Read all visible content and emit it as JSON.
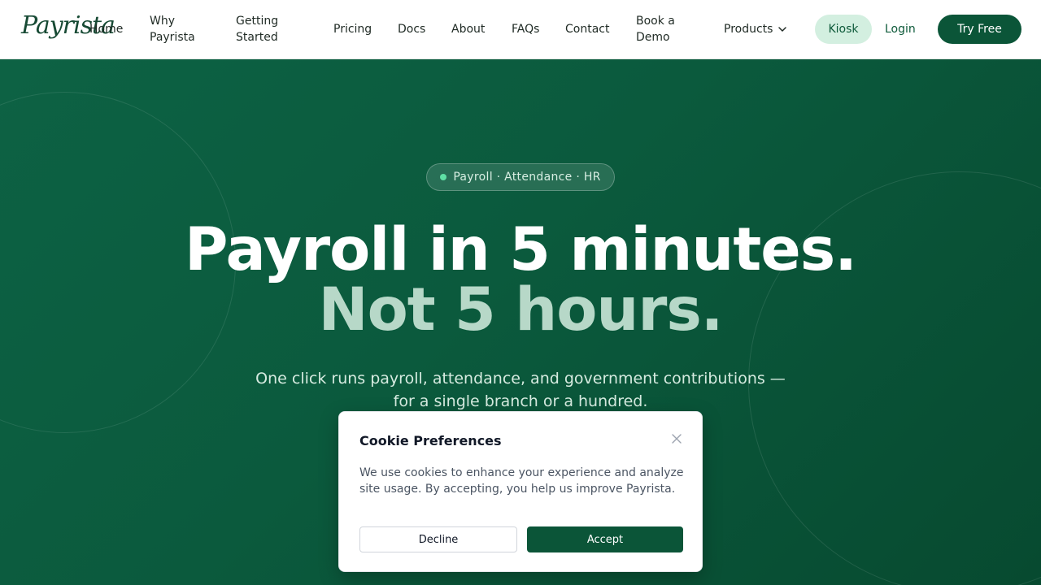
{
  "brand": {
    "logo_text": "Payrista",
    "primary_color": "#0b5538",
    "accent_color": "#5fe0a5"
  },
  "nav": {
    "home": "Home",
    "why_line1": "Why",
    "why_line2": "Payrista",
    "getting_line1": "Getting",
    "getting_line2": "Started",
    "pricing": "Pricing",
    "docs": "Docs",
    "about": "About",
    "faqs": "FAQs",
    "contact": "Contact",
    "demo_line1": "Book a",
    "demo_line2": "Demo",
    "products": "Products",
    "products_icon": "chevron-down-icon",
    "kiosk": "Kiosk",
    "login": "Login",
    "try_free": "Try Free"
  },
  "hero": {
    "pill_text": "Payroll · Attendance · HR",
    "headline_line1": "Payroll in 5 minutes.",
    "headline_line2": "Not 5 hours.",
    "subhead": "One click runs payroll, attendance, and government contributions — for a single branch or a hundred."
  },
  "cookie": {
    "title": "Cookie Preferences",
    "close_icon": "close-icon",
    "text": "We use cookies to enhance your experience and analyze site usage. By accepting, you help us improve Payrista.",
    "decline": "Decline",
    "accept": "Accept"
  }
}
